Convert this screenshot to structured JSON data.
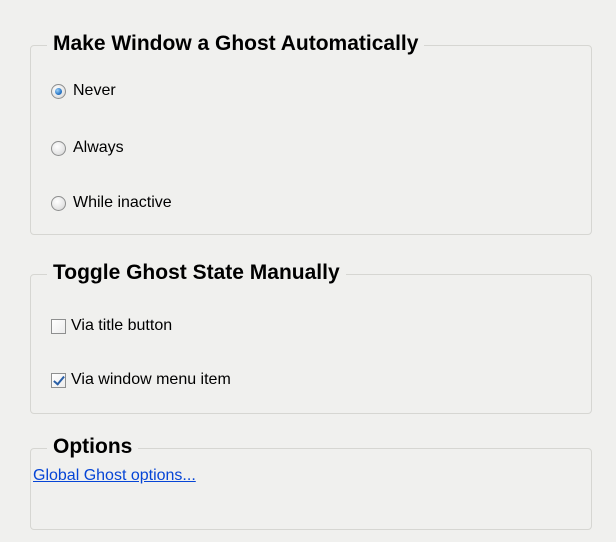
{
  "auto_ghost": {
    "title": "Make Window a Ghost Automatically",
    "options": [
      {
        "label": "Never",
        "checked": true
      },
      {
        "label": "Always",
        "checked": false
      },
      {
        "label": "While inactive",
        "checked": false
      }
    ]
  },
  "manual_ghost": {
    "title": "Toggle Ghost State Manually",
    "options": [
      {
        "label": "Via title button",
        "checked": false
      },
      {
        "label": "Via window menu item",
        "checked": true
      }
    ]
  },
  "options": {
    "title": "Options",
    "link_label": "Global Ghost options..."
  },
  "colors": {
    "link": "#0645d6",
    "panel_background": "#f0f0ee",
    "radio_selected": "#2a78c8"
  }
}
